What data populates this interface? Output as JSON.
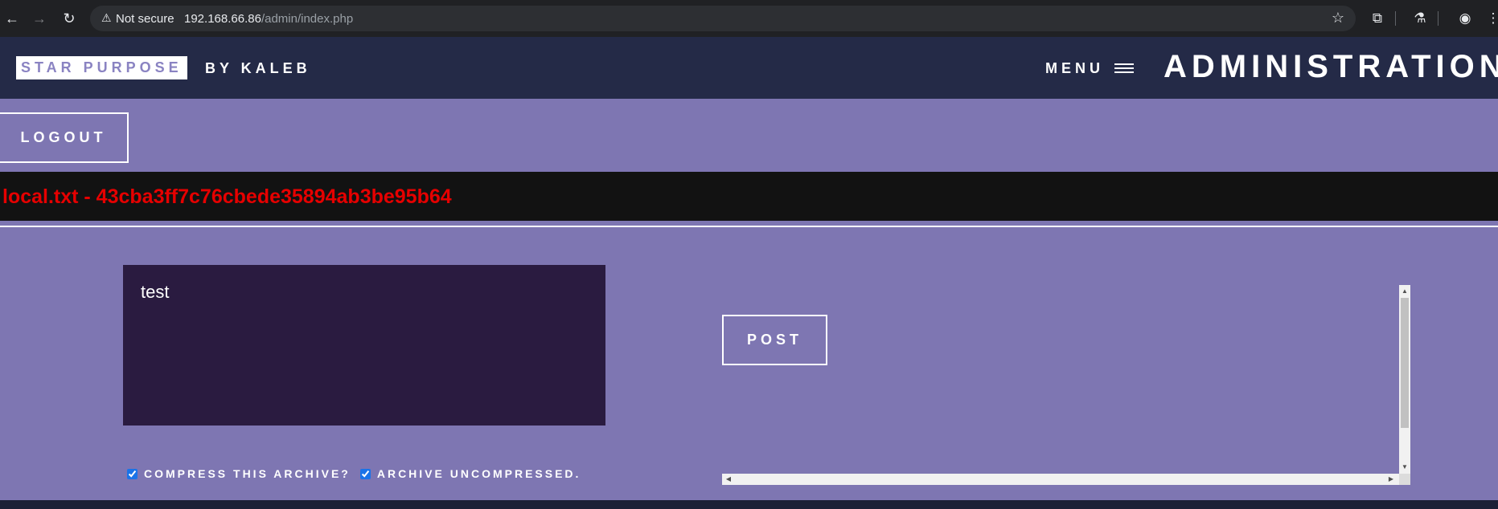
{
  "browser": {
    "security_label": "Not secure",
    "url_host": "192.168.66.86",
    "url_path": "/admin/index.php"
  },
  "header": {
    "brand": "STAR PURPOSE",
    "brand_by": "BY KALEB",
    "menu_label": "MENU",
    "page_title": "ADMINISTRATION"
  },
  "actions": {
    "logout_label": "LOGOUT",
    "post_label": "POST"
  },
  "flag": {
    "text": "local.txt - 43cba3ff7c76cbede35894ab3be95b64",
    "color": "#e60000"
  },
  "post_form": {
    "textarea_value": "test",
    "compress_label": "COMPRESS THIS ARCHIVE?",
    "compress_checked": true,
    "uncompressed_label": "ARCHIVE UNCOMPRESSED.",
    "uncompressed_checked": true
  },
  "icons": {
    "back": "back-arrow-icon",
    "forward": "forward-arrow-icon",
    "reload": "reload-icon",
    "warning": "warning-triangle-icon",
    "bookmark": "star-icon",
    "extensions": "puzzle-icon",
    "labs": "flask-icon",
    "profile": "profile-icon",
    "more": "kebab-menu-icon",
    "menu": "hamburger-icon"
  },
  "colors": {
    "header_bg": "#242a47",
    "content_bg": "#7e76b2",
    "flag_bar_bg": "#121212",
    "textarea_bg": "#2a1b40"
  }
}
